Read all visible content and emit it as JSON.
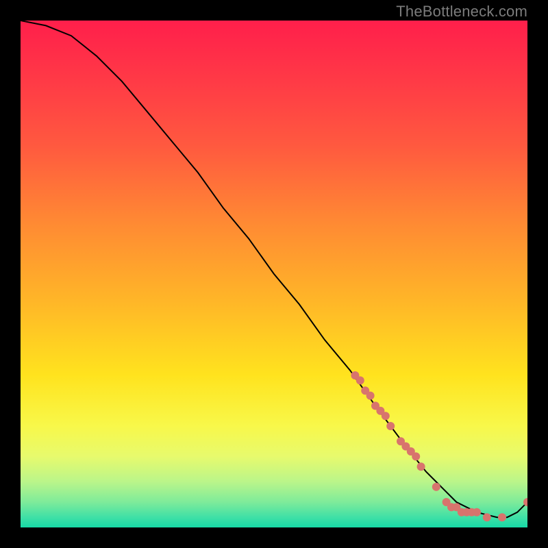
{
  "watermark": "TheBottleneck.com",
  "chart_data": {
    "type": "line",
    "title": "",
    "xlabel": "",
    "ylabel": "",
    "xlim": [
      0,
      100
    ],
    "ylim": [
      0,
      100
    ],
    "grid": false,
    "legend": false,
    "series": [
      {
        "name": "bottleneck-curve",
        "x": [
          0,
          5,
          10,
          15,
          20,
          25,
          30,
          35,
          40,
          45,
          50,
          55,
          60,
          65,
          70,
          73,
          76,
          80,
          83,
          86,
          90,
          94,
          96,
          98,
          100
        ],
        "y": [
          100,
          99,
          97,
          93,
          88,
          82,
          76,
          70,
          63,
          57,
          50,
          44,
          37,
          31,
          24,
          20,
          16,
          11,
          8,
          5,
          3,
          2,
          2,
          3,
          5
        ],
        "stroke": "#000000",
        "markers": false
      },
      {
        "name": "highlighted-points",
        "x": [
          66,
          67,
          68,
          69,
          70,
          71,
          72,
          73,
          75,
          76,
          77,
          78,
          79,
          82,
          84,
          85,
          86,
          87,
          88,
          89,
          90,
          92,
          95,
          100
        ],
        "y": [
          30,
          29,
          27,
          26,
          24,
          23,
          22,
          20,
          17,
          16,
          15,
          14,
          12,
          8,
          5,
          4,
          4,
          3,
          3,
          3,
          3,
          2,
          2,
          5
        ],
        "stroke": "none",
        "markers": true,
        "marker_color": "#d8746d",
        "marker_radius": 6
      }
    ],
    "background_gradient": {
      "stops": [
        {
          "offset": 0.0,
          "color": "#ff1f4b"
        },
        {
          "offset": 0.12,
          "color": "#ff3a46"
        },
        {
          "offset": 0.25,
          "color": "#ff5a3f"
        },
        {
          "offset": 0.4,
          "color": "#ff8a33"
        },
        {
          "offset": 0.55,
          "color": "#ffb528"
        },
        {
          "offset": 0.7,
          "color": "#ffe31e"
        },
        {
          "offset": 0.8,
          "color": "#f8f84a"
        },
        {
          "offset": 0.86,
          "color": "#e7fa6d"
        },
        {
          "offset": 0.91,
          "color": "#baf58a"
        },
        {
          "offset": 0.95,
          "color": "#7eeb9a"
        },
        {
          "offset": 0.98,
          "color": "#3fe0a6"
        },
        {
          "offset": 1.0,
          "color": "#16d9a6"
        }
      ]
    }
  }
}
